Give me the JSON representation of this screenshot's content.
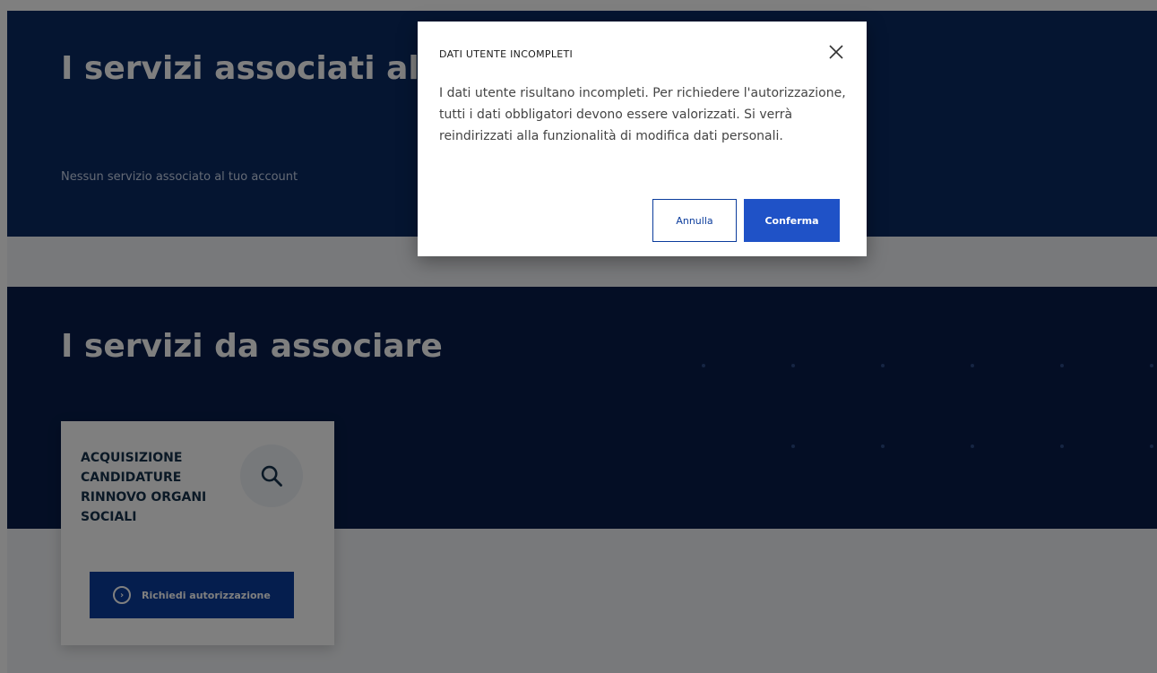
{
  "section_associated": {
    "title": "I servizi associati al tuo account",
    "empty_text": "Nessun servizio associato al tuo account"
  },
  "section_to_associate": {
    "title": "I servizi da associare",
    "card": {
      "title": "ACQUISIZIONE\nCANDIDATURE\nRINNOVO ORGANI\nSOCIALI",
      "search_icon": "search-icon",
      "button_label": "Richiedi autorizzazione",
      "button_icon": "circle-chevron-icon"
    }
  },
  "modal": {
    "title": "DATI UTENTE INCOMPLETI",
    "body": "I dati utente risultano incompleti. Per richiedere l'autorizzazione, tutti i dati obbligatori devono essere valorizzati. Si verrà reindirizzati alla funzionalità di modifica dati personali.",
    "cancel_label": "Annulla",
    "confirm_label": "Conferma",
    "close_icon": "close-icon"
  },
  "colors": {
    "header_blue": "#0b2a63",
    "dark_blue": "#081d4a",
    "primary_button": "#1f52c7",
    "overlay": "rgba(0,0,0,0.5)"
  }
}
